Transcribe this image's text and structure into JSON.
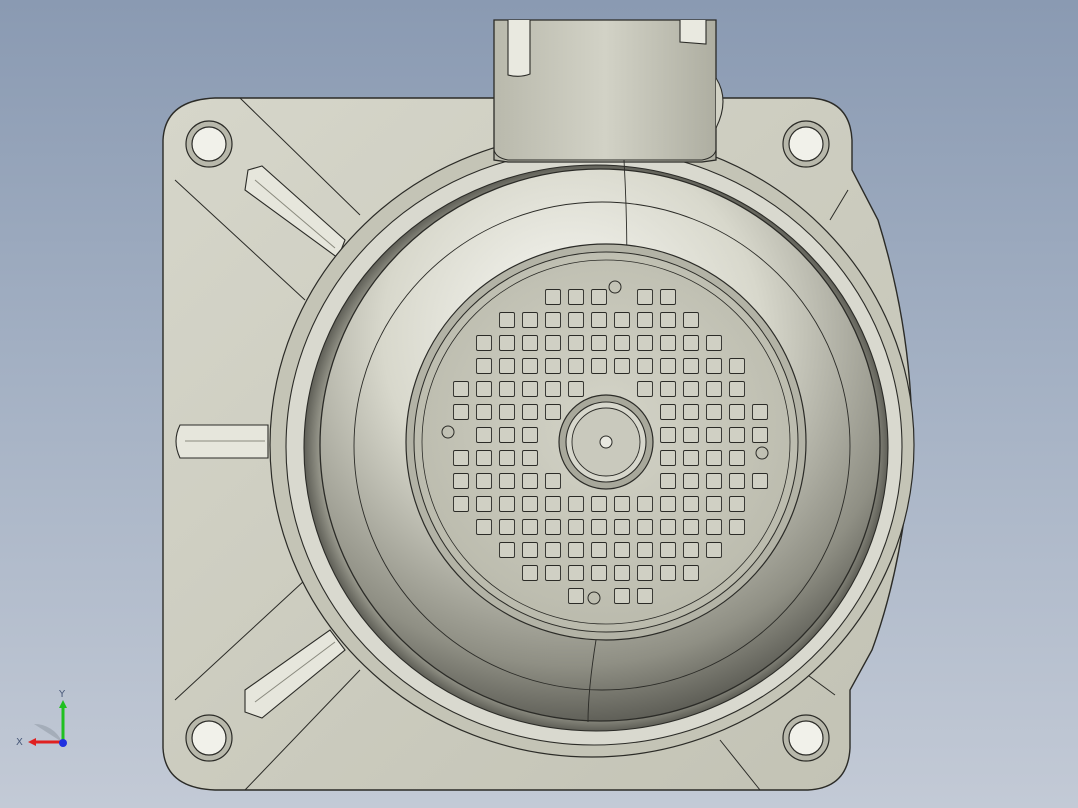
{
  "viewport": {
    "background_top": "#8a9ab2",
    "background_bottom": "#c3cad6"
  },
  "model": {
    "body_color": "#c9c9bc",
    "edge_color": "#2b2b27"
  },
  "triad": {
    "x_label": "X",
    "y_label": "Y",
    "x_color": "#e02020",
    "y_color": "#20c020",
    "z_color": "#2030e0"
  }
}
